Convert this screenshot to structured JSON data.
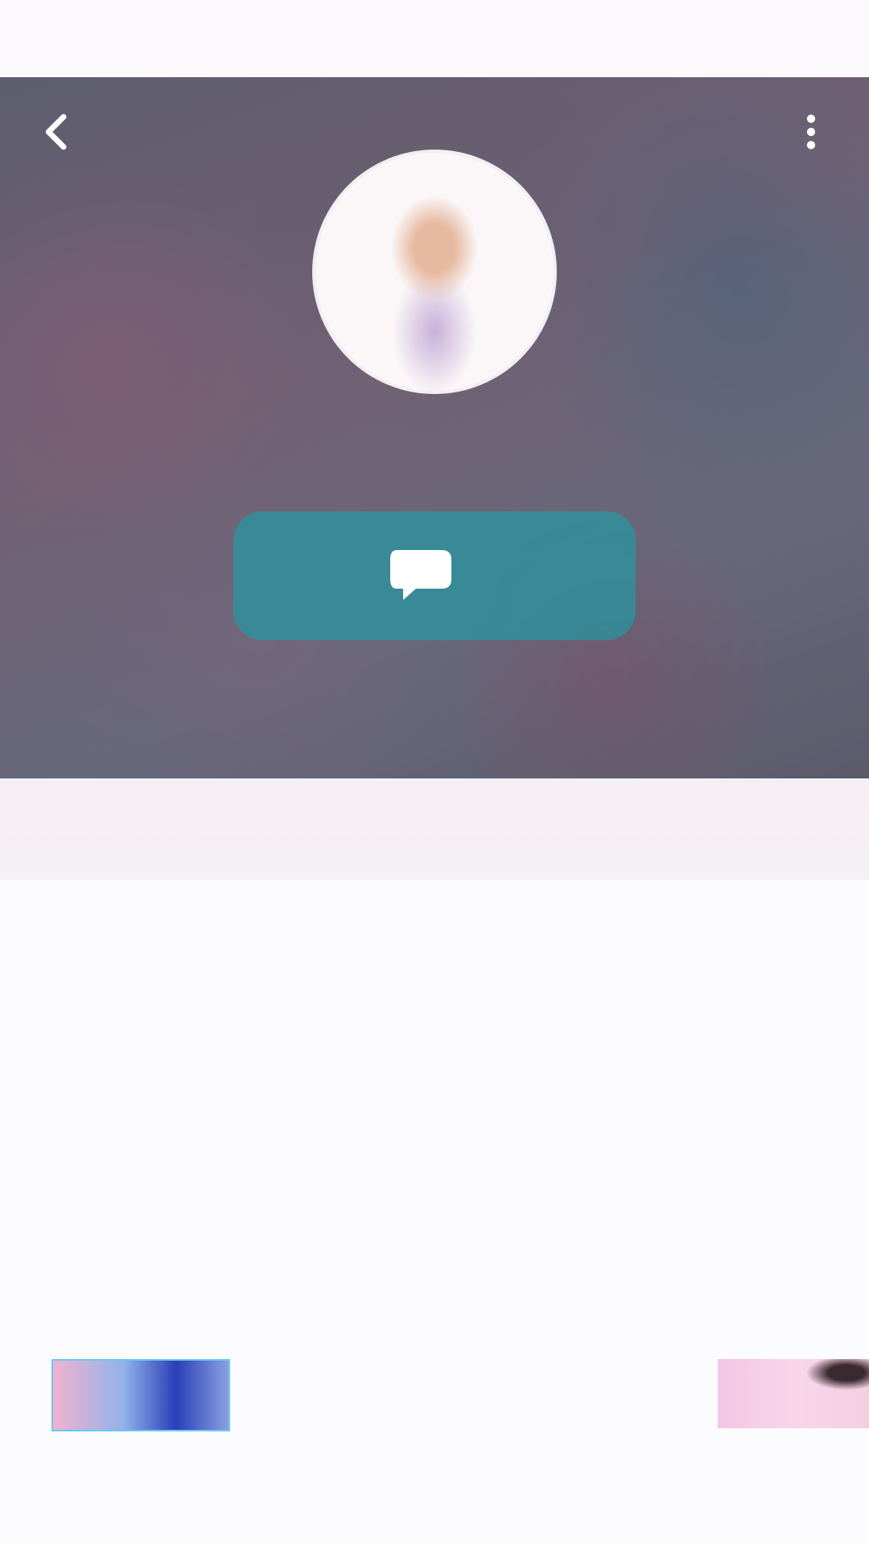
{
  "profile": {
    "name": "",
    "handle": "",
    "avatar_icon": "profile-photo"
  },
  "header": {
    "back_icon": "back-arrow-icon",
    "menu_icon": "more-vertical-icon"
  },
  "chat_button": {
    "icon": "chat-bubble-icon",
    "label": "",
    "color": "#2896a0",
    "glow": "#3cf0ff"
  },
  "stats": [
    {
      "value": "",
      "label": ""
    },
    {
      "value": "",
      "label": ""
    },
    {
      "value": "",
      "label": ""
    }
  ],
  "colors": {
    "page_background": "#fdfbfd",
    "hero_tint": "#7d7488",
    "text_on_hero": "#ffffff"
  }
}
